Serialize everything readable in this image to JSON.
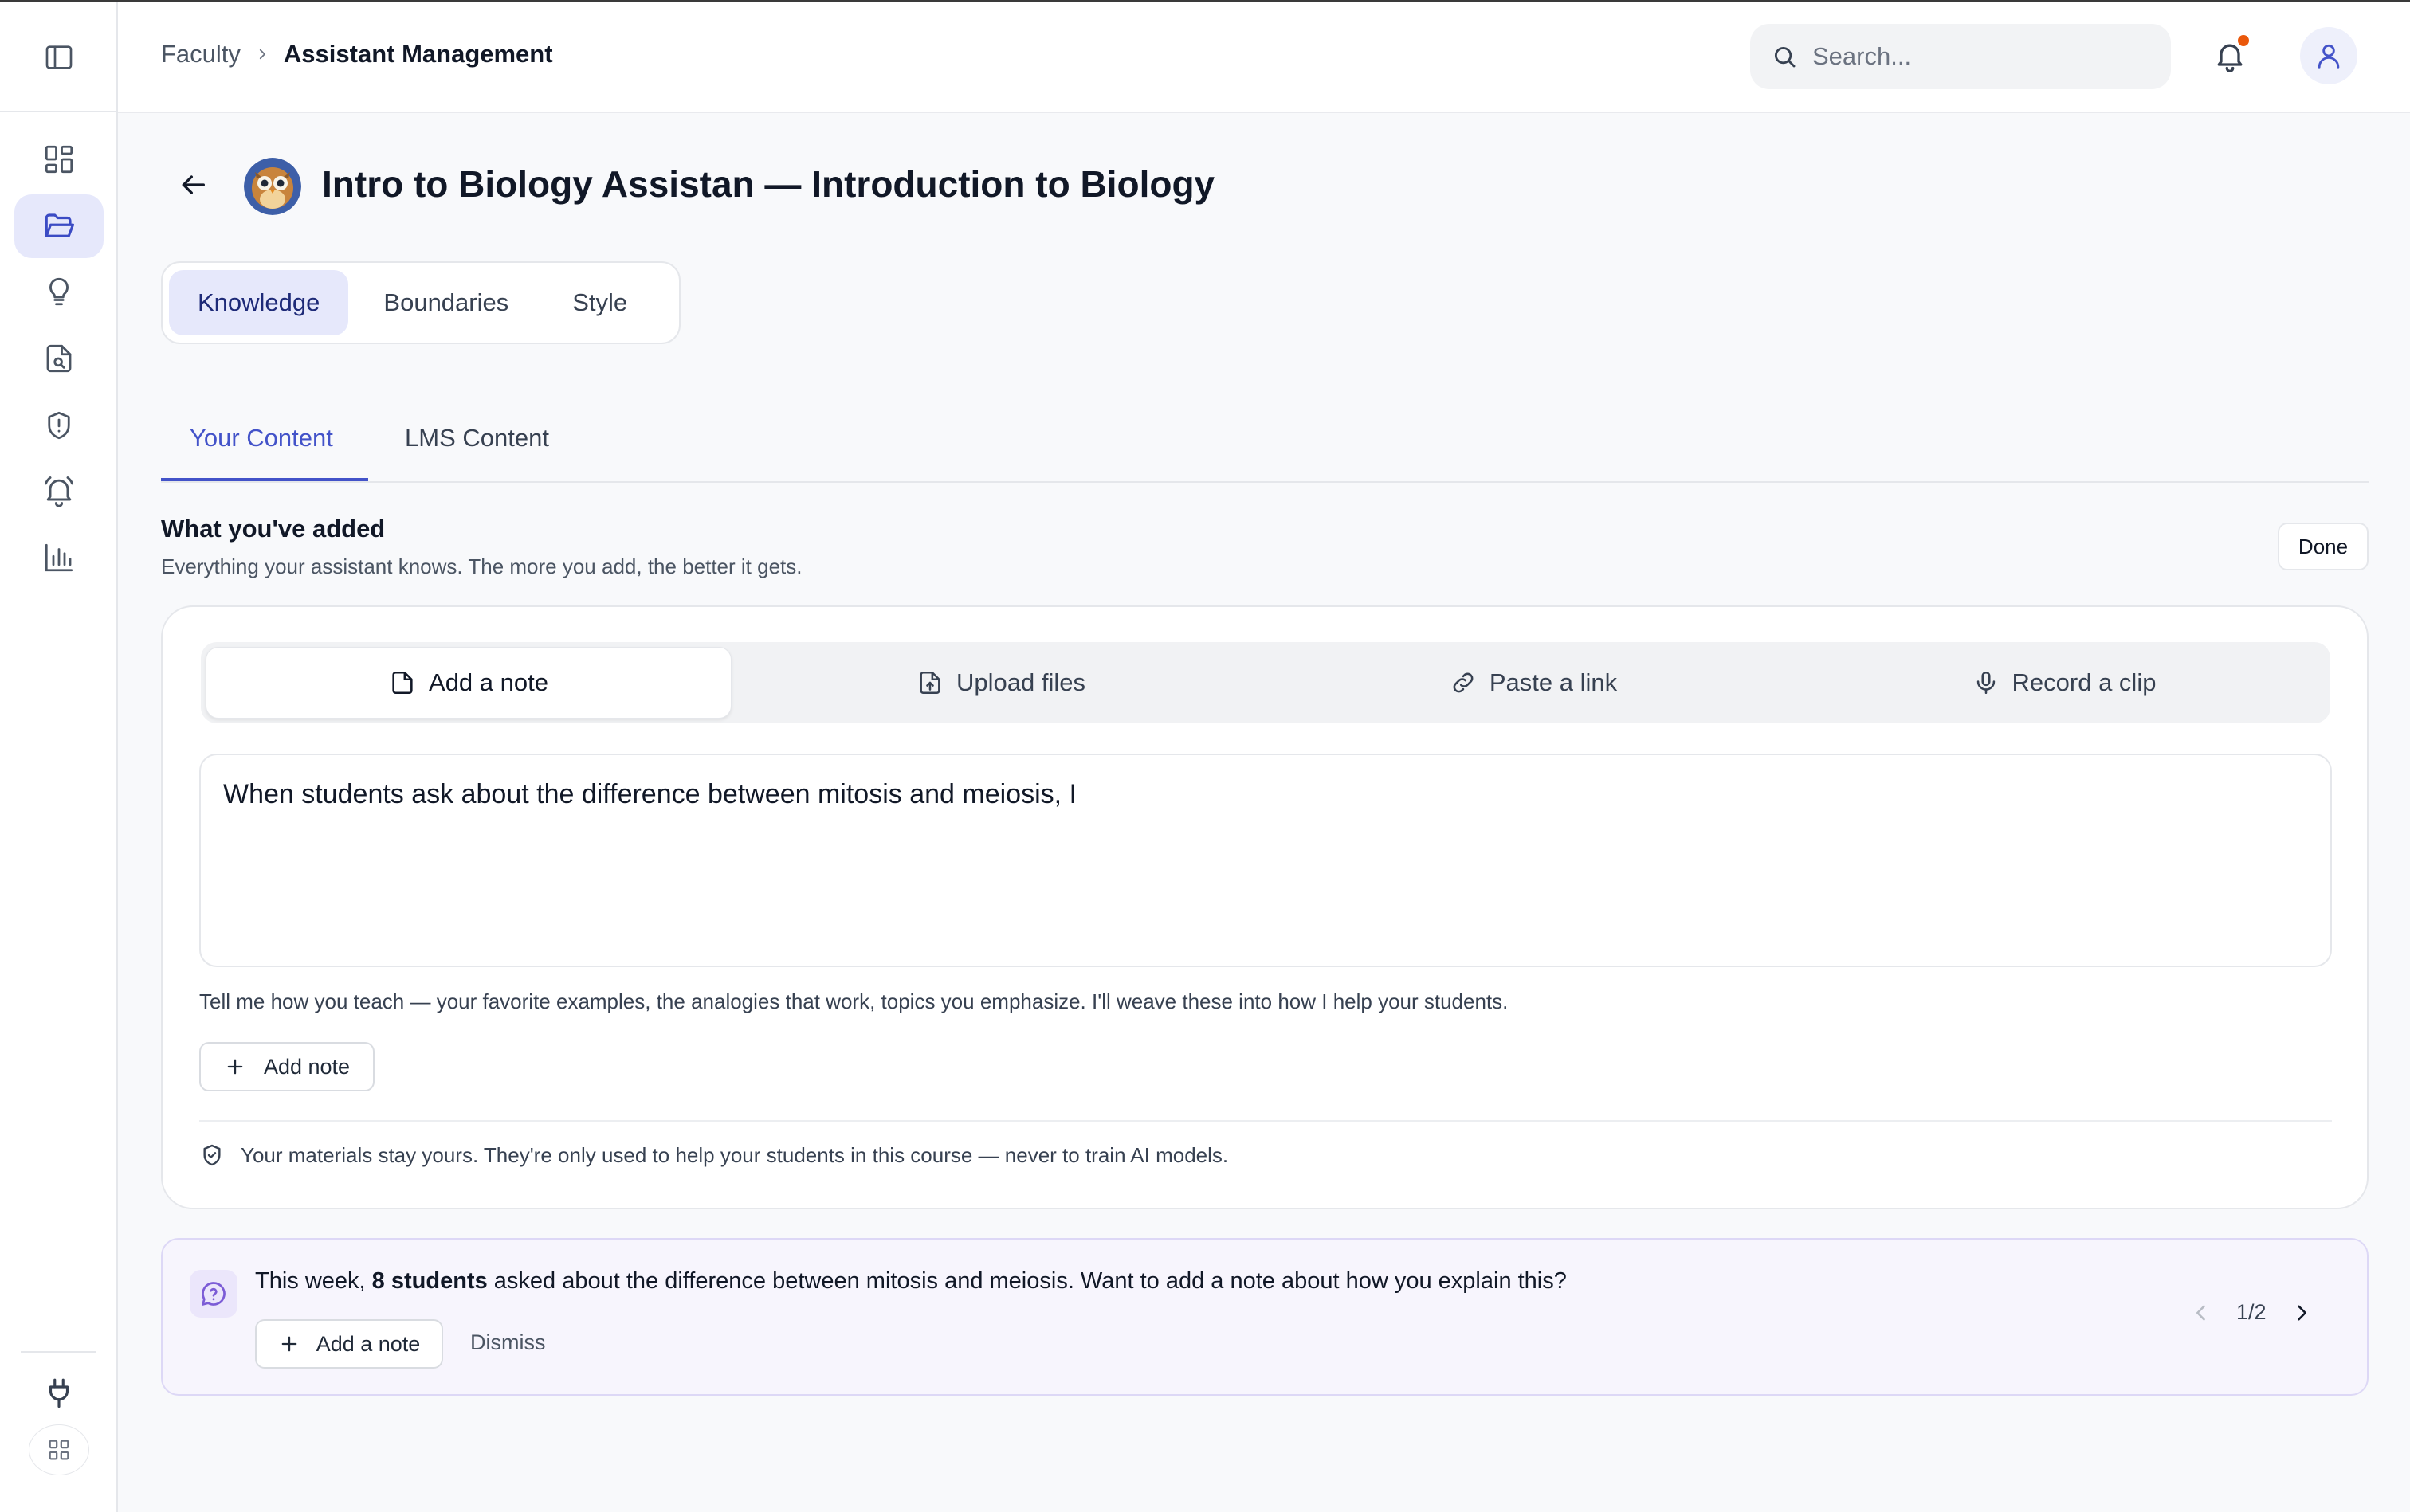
{
  "header": {
    "breadcrumb": {
      "parent": "Faculty",
      "current": "Assistant Management"
    },
    "search_placeholder": "Search...",
    "notification_dot_color": "#ea580c"
  },
  "sidebar": {
    "items": [
      {
        "name": "dashboard",
        "icon": "dashboard-grid-icon"
      },
      {
        "name": "folders",
        "icon": "folder-open-icon",
        "active": true
      },
      {
        "name": "ideas",
        "icon": "lightbulb-icon"
      },
      {
        "name": "document-search",
        "icon": "file-search-icon"
      },
      {
        "name": "alerts",
        "icon": "shield-alert-icon"
      },
      {
        "name": "notifications",
        "icon": "alarm-bell-icon"
      },
      {
        "name": "analytics",
        "icon": "bar-chart-icon"
      }
    ],
    "bottom_items": [
      {
        "name": "integrations",
        "icon": "plug-icon"
      },
      {
        "name": "apps",
        "icon": "apps-grid-icon"
      }
    ]
  },
  "page": {
    "title": "Intro to Biology Assistan — Introduction to Biology",
    "tabs": [
      "Knowledge",
      "Boundaries",
      "Style"
    ],
    "active_tab": "Knowledge",
    "sub_tabs": [
      "Your Content",
      "LMS Content"
    ],
    "active_sub_tab": "Your Content"
  },
  "section": {
    "title": "What you've added",
    "subtitle": "Everything your assistant knows. The more you add, the better it gets.",
    "done_label": "Done"
  },
  "composer": {
    "input_tabs": [
      {
        "label": "Add a note",
        "icon": "note-icon"
      },
      {
        "label": "Upload files",
        "icon": "file-upload-icon"
      },
      {
        "label": "Paste a link",
        "icon": "link-icon"
      },
      {
        "label": "Record a clip",
        "icon": "microphone-icon"
      }
    ],
    "note_value": "When students ask about the difference between mitosis and meiosis, I",
    "hint": "Tell me how you teach — your favorite examples, the analogies that work, topics you emphasize. I'll weave these into how I help your students.",
    "add_note_label": "Add note",
    "privacy_text": "Your materials stay yours. They're only used to help your students in this course — never to train AI models."
  },
  "suggestion": {
    "text_before": "This week, ",
    "text_bold": "8 students",
    "text_after": " asked about the difference between mitosis and meiosis. Want to add a note about how you explain this?",
    "add_label": "Add a note",
    "dismiss_label": "Dismiss",
    "pager": "1/2"
  },
  "colors": {
    "accent": "#4353c9",
    "active_tab_bg": "#e6e8fb",
    "suggestion_bg": "#f7f5fd"
  }
}
